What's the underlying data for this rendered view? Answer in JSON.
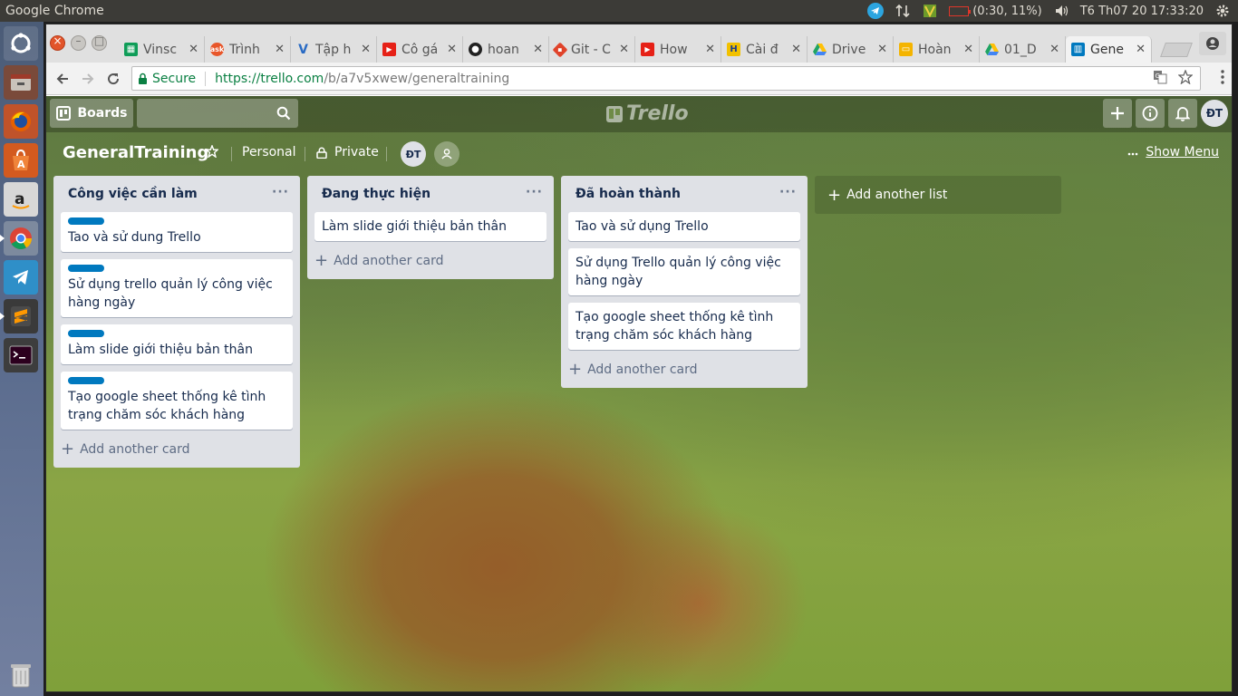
{
  "os_panel": {
    "app_title": "Google Chrome",
    "battery": "(0:30, 11%)",
    "clock": "T6 Th07 20 17:33:20"
  },
  "launcher": {
    "items": [
      "files",
      "firefox",
      "software-center",
      "amazon",
      "chrome",
      "telegram",
      "sublime-text",
      "terminal"
    ]
  },
  "browser": {
    "tabs": [
      {
        "label": "Vinsc",
        "icon": "sheets-icon",
        "color": "#0f9d58"
      },
      {
        "label": "Trình",
        "icon": "ask-icon",
        "color": "#e8562a"
      },
      {
        "label": "Tập h",
        "icon": "v-icon",
        "color": "#2a6bc4"
      },
      {
        "label": "Cô gá",
        "icon": "youtube-icon",
        "color": "#e62117"
      },
      {
        "label": "hoan",
        "icon": "github-icon",
        "color": "#222222"
      },
      {
        "label": "Git - C",
        "icon": "git-icon",
        "color": "#e0432a"
      },
      {
        "label": "How",
        "icon": "youtube-icon",
        "color": "#e62117"
      },
      {
        "label": "Cài đ",
        "icon": "h-icon",
        "color": "#f2c100"
      },
      {
        "label": "Drive",
        "icon": "drive-icon",
        "color": "#1fa463"
      },
      {
        "label": "Hoàn",
        "icon": "slides-icon",
        "color": "#f4b400"
      },
      {
        "label": "01_D",
        "icon": "drive-icon",
        "color": "#1fa463"
      },
      {
        "label": "Gene",
        "icon": "trello-icon",
        "color": "#0079bf",
        "active": true
      }
    ],
    "secure_label": "Secure",
    "url_scheme_host": "https://trello.com",
    "url_path": "/b/a7v5xwew/generaltraining"
  },
  "trello": {
    "header": {
      "boards_label": "Boards",
      "logo_text": "Trello",
      "user_initials": "ĐT"
    },
    "board": {
      "title": "GeneralTraining",
      "team": "Personal",
      "visibility": "Private",
      "member_initials": "ĐT",
      "show_menu": "Show Menu"
    },
    "lists": [
      {
        "title": "Công việc cần làm",
        "cards": [
          {
            "text": "Tao và sử dung Trello",
            "label_color": "#0079bf"
          },
          {
            "text": "Sử dụng trello quản lý công việc hàng ngày",
            "label_color": "#0079bf"
          },
          {
            "text": "Làm slide giới thiệu bản thân",
            "label_color": "#0079bf"
          },
          {
            "text": "Tạo google sheet thống kê tình trạng chăm sóc khách hàng",
            "label_color": "#0079bf"
          }
        ],
        "add_card": "Add another card"
      },
      {
        "title": "Đang thực hiện",
        "cards": [
          {
            "text": "Làm slide giới thiệu bản thân"
          }
        ],
        "add_card": "Add another card"
      },
      {
        "title": "Đã hoàn thành",
        "cards": [
          {
            "text": "Tao và sử dụng Trello"
          },
          {
            "text": "Sử dụng Trello quản lý công việc hàng ngày"
          },
          {
            "text": "Tạo google sheet thống kê tình trạng chăm sóc khách hàng"
          }
        ],
        "add_card": "Add another card"
      }
    ],
    "add_list": "Add another list"
  }
}
